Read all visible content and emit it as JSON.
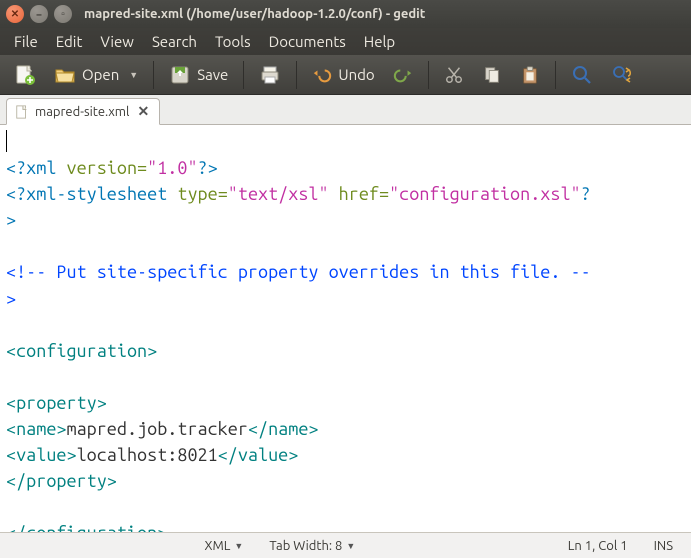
{
  "window": {
    "title": "mapred-site.xml (/home/user/hadoop-1.2.0/conf) - gedit"
  },
  "menubar": {
    "items": [
      "File",
      "Edit",
      "View",
      "Search",
      "Tools",
      "Documents",
      "Help"
    ]
  },
  "toolbar": {
    "open_label": "Open",
    "save_label": "Save",
    "undo_label": "Undo"
  },
  "tab": {
    "filename": "mapred-site.xml"
  },
  "code": {
    "l1_pi_open": "<?xml",
    "l1_attr": " version",
    "l1_eq": "=",
    "l1_str": "\"1.0\"",
    "l1_pi_close": "?>",
    "l2_pi_open": "<?xml-stylesheet",
    "l2_attr1": " type",
    "l2_str1": "\"text/xsl\"",
    "l2_attr2": " href",
    "l2_str2": "\"configuration.xsl\"",
    "l2_pi_close": "?",
    "l3_pi_close": ">",
    "cmt_open": "<!--",
    "cmt_body": " Put site-specific property overrides in this file. ",
    "cmt_dashes": "--",
    "cmt_close": ">",
    "cfg_open": "<configuration>",
    "prop_open": "<property>",
    "name_open": "<name>",
    "name_text": "mapred.job.tracker",
    "name_close": "</name>",
    "value_open": "<value>",
    "value_text": "localhost:8021",
    "value_close": "</value>",
    "prop_close": "</property>",
    "cfg_close": "</configuration>"
  },
  "statusbar": {
    "language": "XML",
    "tabwidth_label": "Tab Width: 8",
    "position": "Ln 1, Col 1",
    "insert_mode": "INS"
  }
}
